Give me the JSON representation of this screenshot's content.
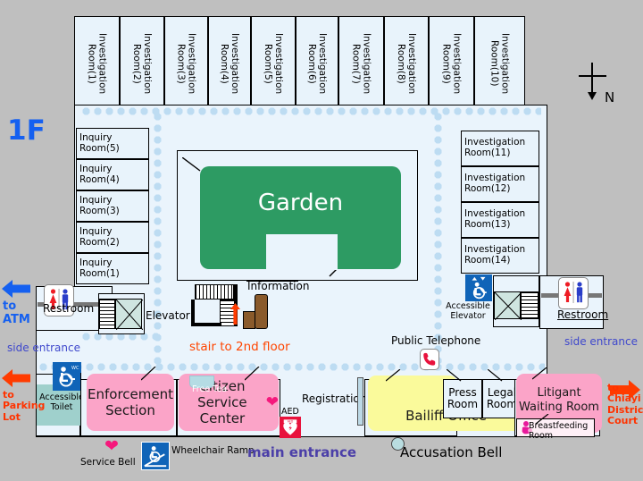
{
  "plan": {
    "floor_label": "1F",
    "compass": {
      "label": "N",
      "direction": "down"
    },
    "garden_label": "Garden",
    "main_entrance": "main entrance",
    "side_entrance_left": "side entrance",
    "side_entrance_right": "side entrance"
  },
  "investigation_rooms_top": [
    "Investigation Room(1)",
    "Investigation Room(2)",
    "Investigation Room(3)",
    "Investigation Room(4)",
    "Investigation Room(5)",
    "Investigation Room(6)",
    "Investigation Room(7)",
    "Investigation Room(8)",
    "Investigation Room(9)",
    "Investigation Room(10)"
  ],
  "investigation_rooms_right": [
    "Investigation Room(11)",
    "Investigation Room(12)",
    "Investigation Room(13)",
    "Investigation Room(14)"
  ],
  "inquiry_rooms_left": [
    "Inquiry Room(5)",
    "Inquiry Room(4)",
    "Inquiry Room(3)",
    "Inquiry Room(2)",
    "Inquiry Room(1)"
  ],
  "facilities": {
    "restroom_left": "Restroom",
    "restroom_right": "Restroom",
    "elevator": "Elevator",
    "accessible_elevator": "Accessible Elevator",
    "accessible_toilet": "Accessible Toilet",
    "information": "Information",
    "stair_to_2nd_floor": "stair to 2nd floor",
    "public_telephone": "Public Telephone",
    "aed": "AED",
    "free_tea": "Free Tea",
    "service_bell": "Service Bell",
    "wheelchair_ramp": "Wheelchair Ramp",
    "accusation_bell": "Accusation Bell",
    "registration": "Registration",
    "breastfeeding_room": "Breastfeeding Room"
  },
  "offices": {
    "enforcement_section": "Enforcement Section",
    "citizen_service_center": "Citizen Service Center",
    "bailiff_office": "Bailiff Office",
    "press_room": "Press Room",
    "legal_room": "Legal Room",
    "litigant_waiting_room": "Litigant Waiting Room"
  },
  "wayfinding": {
    "to_atm": "to ATM",
    "to_parking_lot": "to Parking Lot",
    "to_chiayi_district_court": "to Chiayi District Court"
  },
  "colors": {
    "background": "#bfbfbf",
    "interior": "#eaf4fc",
    "room_fill": "#e8f3fb",
    "garden": "#2d9b63",
    "pink_block": "#fba4c8",
    "yellow_block": "#fafa9b",
    "blue_text": "#1560f0",
    "red_text": "#ff4500",
    "purple_text": "#4b3fa8",
    "accessible_blue": "#1064b8",
    "aed_red": "#e8123c",
    "corridor_dot": "#bddcf2"
  }
}
